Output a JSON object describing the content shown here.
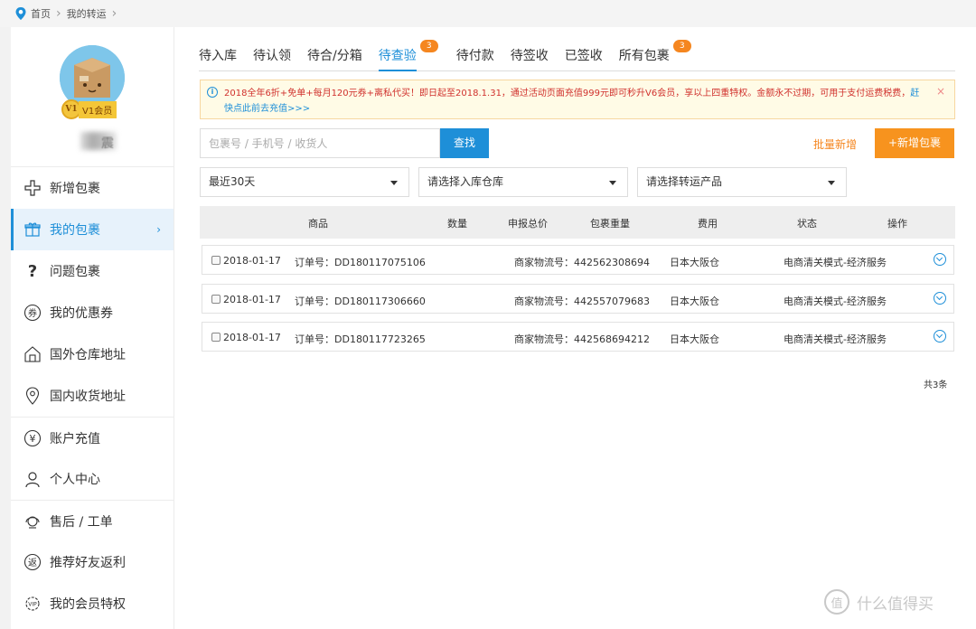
{
  "breadcrumb": {
    "home": "首页",
    "current": "我的转运"
  },
  "profile": {
    "vip_level": "V1",
    "vip_label": "V1会员",
    "username": "震"
  },
  "sidebar": {
    "items": [
      {
        "label": "新增包裹",
        "icon": "plus-icon"
      },
      {
        "label": "我的包裹",
        "icon": "gift-box-icon",
        "active": true
      },
      {
        "label": "问题包裹",
        "icon": "question-icon"
      },
      {
        "label": "我的优惠券",
        "icon": "coupon-icon"
      },
      {
        "label": "国外仓库地址",
        "icon": "warehouse-icon"
      },
      {
        "label": "国内收货地址",
        "icon": "location-pin-icon"
      },
      {
        "label": "账户充值",
        "icon": "yen-icon"
      },
      {
        "label": "个人中心",
        "icon": "user-icon"
      },
      {
        "label": "售后 / 工单",
        "icon": "headset-icon"
      },
      {
        "label": "推荐好友返利",
        "icon": "rebate-icon"
      },
      {
        "label": "我的会员特权",
        "icon": "vip-gear-icon"
      }
    ]
  },
  "tabs": [
    {
      "label": "待入库"
    },
    {
      "label": "待认领"
    },
    {
      "label": "待合/分箱"
    },
    {
      "label": "待查验",
      "badge": "3",
      "active": true
    },
    {
      "label": "待付款"
    },
    {
      "label": "待签收"
    },
    {
      "label": "已签收"
    },
    {
      "label": "所有包裹",
      "badge": "3"
    }
  ],
  "notice": {
    "text": "2018全年6折+免单+每月120元券+离私代买！即日起至2018.1.31，通过活动页面充值999元即可秒升V6会员，享以上四重特权。金额永不过期，可用于支付运费税费，",
    "link": "赶快点此前去充值>>>"
  },
  "search": {
    "placeholder": "包裹号 / 手机号 / 收货人",
    "button": "查找"
  },
  "actions": {
    "batch_add": "批量新增",
    "add_package": "+新增包裹"
  },
  "filters": {
    "date_range": "最近30天",
    "warehouse": "请选择入库仓库",
    "product": "请选择转运产品"
  },
  "table": {
    "headers": [
      "商品",
      "数量",
      "申报总价",
      "包裹重量",
      "费用",
      "状态",
      "操作"
    ],
    "rows": [
      {
        "date": "2018-01-17",
        "order": "订单号：DD180117075106",
        "tracking": "商家物流号：442562308694",
        "warehouse": "日本大阪仓",
        "service": "电商清关模式-经济服务"
      },
      {
        "date": "2018-01-17",
        "order": "订单号：DD180117306660",
        "tracking": "商家物流号：442557079683",
        "warehouse": "日本大阪仓",
        "service": "电商清关模式-经济服务"
      },
      {
        "date": "2018-01-17",
        "order": "订单号：DD180117723265",
        "tracking": "商家物流号：442568694212",
        "warehouse": "日本大阪仓",
        "service": "电商清关模式-经济服务"
      }
    ],
    "total": "共3条"
  },
  "watermark": {
    "text": "什么值得买",
    "icon_char": "值"
  },
  "colors": {
    "accent": "#1e8fd8",
    "orange": "#f7931e",
    "notice_text": "#d0312d"
  }
}
